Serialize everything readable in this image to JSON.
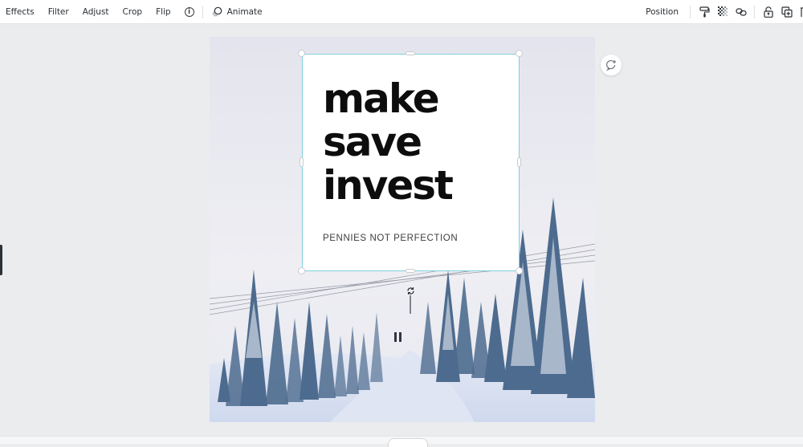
{
  "toolbar": {
    "left_items": [
      "Effects",
      "Filter",
      "Adjust",
      "Crop",
      "Flip"
    ],
    "info_glyph": "i",
    "animate_label": "Animate",
    "position_label": "Position",
    "right_icons": [
      "paint-roller-icon",
      "transparency-icon",
      "link-icon",
      "lock-icon",
      "duplicate-icon",
      "trash-icon"
    ]
  },
  "design": {
    "headline_lines": [
      "make",
      "save",
      "invest"
    ],
    "subline": "PENNIES NOT PERFECTION",
    "background_description": "snowy pine forest with ski lift cables"
  },
  "colors": {
    "selection_border": "#7fd1db",
    "headline_text": "#0d0d0d",
    "canvas_background": "#ebecee"
  }
}
